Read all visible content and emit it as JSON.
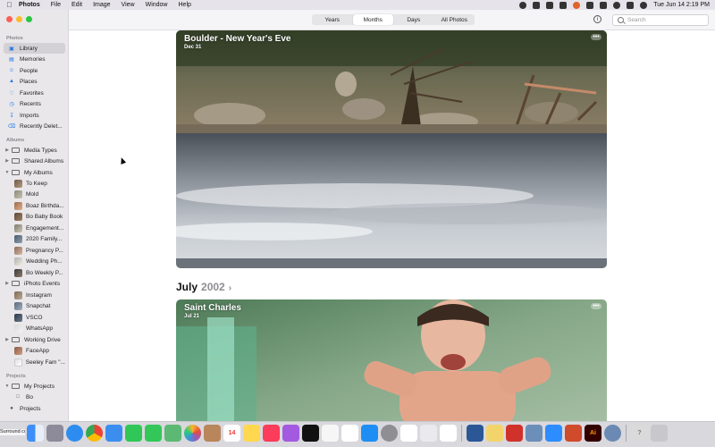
{
  "menubar": {
    "app_name": "Photos",
    "items": [
      "File",
      "Edit",
      "Image",
      "View",
      "Window",
      "Help"
    ],
    "clock": "Tue Jun 14  2:19 PM"
  },
  "toolbar": {
    "segments": [
      {
        "label": "Years",
        "active": false
      },
      {
        "label": "Months",
        "active": true
      },
      {
        "label": "Days",
        "active": false
      },
      {
        "label": "All Photos",
        "active": false
      }
    ],
    "info_icon": "info-icon",
    "search_placeholder": "Search"
  },
  "sidebar": {
    "sections": {
      "photos": "Photos",
      "albums": "Albums",
      "projects": "Projects"
    },
    "photos_items": [
      {
        "label": "Library",
        "icon": "photo-library-icon",
        "selected": true
      },
      {
        "label": "Memories",
        "icon": "memories-icon"
      },
      {
        "label": "People",
        "icon": "people-icon"
      },
      {
        "label": "Places",
        "icon": "places-icon"
      },
      {
        "label": "Favorites",
        "icon": "heart-icon"
      },
      {
        "label": "Recents",
        "icon": "clock-icon"
      },
      {
        "label": "Imports",
        "icon": "import-icon"
      },
      {
        "label": "Recently Delet...",
        "icon": "trash-icon"
      }
    ],
    "album_groups": [
      {
        "label": "Media Types",
        "icon": "folder-icon"
      },
      {
        "label": "Shared Albums",
        "icon": "folder-icon"
      },
      {
        "label": "My Albums",
        "icon": "folder-icon"
      }
    ],
    "my_albums": [
      "To Keep",
      "Mold",
      "Boaz Birthda...",
      "Bo Baby Book",
      "Engagement...",
      "2020 Family...",
      "Pregnancy P...",
      "Wedding Ph...",
      "Bo Weekly P..."
    ],
    "other_albums": [
      {
        "label": "iPhoto Events",
        "folder": true
      },
      {
        "label": "Instagram",
        "folder": false
      },
      {
        "label": "Snapchat",
        "folder": false
      },
      {
        "label": "VSCO",
        "folder": false
      },
      {
        "label": "WhatsApp",
        "folder": false
      },
      {
        "label": "Working Drive",
        "folder": true
      },
      {
        "label": "FaceApp",
        "folder": false
      },
      {
        "label": "Seeley Fam \"...",
        "folder": false
      }
    ],
    "projects": [
      {
        "label": "My Projects",
        "icon": "folder-icon"
      },
      {
        "label": "Bo",
        "icon": "book-icon"
      },
      {
        "label": "Projects",
        "icon": "projects-icon"
      }
    ]
  },
  "main": {
    "card1": {
      "title": "Boulder - New Year's Eve",
      "date": "Dec 31",
      "more": "•••"
    },
    "section": {
      "month": "July",
      "year": "2002"
    },
    "card2": {
      "title": "Saint Charles",
      "date": "Jul 21",
      "more": "•••"
    }
  },
  "dock": {
    "desktop_label": "Surround copy.a",
    "calendar_day": "14",
    "apps": [
      "finder",
      "launchpad",
      "safari",
      "chrome",
      "mail",
      "facetime",
      "messages",
      "maps",
      "photos",
      "contacts",
      "calendar",
      "notes",
      "music",
      "podcasts",
      "tv",
      "news",
      "slack",
      "app-store",
      "settings",
      "notion",
      "word",
      "notes-yellow",
      "acrobat",
      "preview",
      "zoom",
      "powerpoint",
      "illustrator",
      "other",
      "help",
      "trash"
    ]
  }
}
